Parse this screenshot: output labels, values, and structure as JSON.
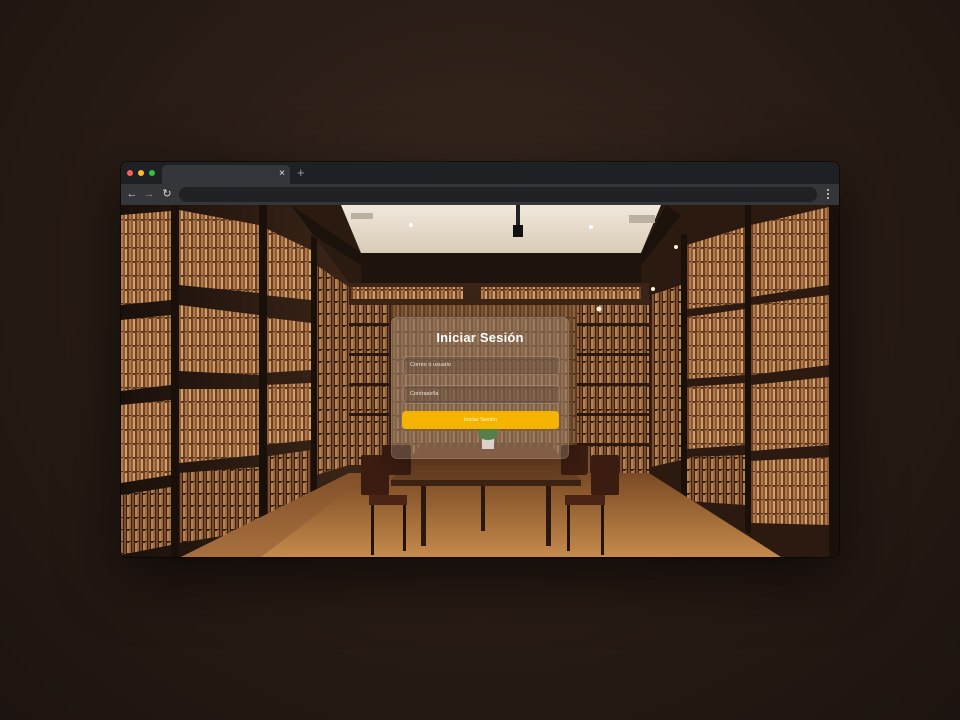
{
  "browser": {
    "tab_close": "×",
    "new_tab": "+",
    "back": "←",
    "forward": "→",
    "reload": "↻"
  },
  "login": {
    "title": "Iniciar Sesión",
    "user_placeholder": "Correo o usuario",
    "password_placeholder": "Contraseña",
    "submit_label": "Iniciar Sesión"
  },
  "colors": {
    "button": "#f5b400",
    "card": "rgba(190,175,160,0.28)"
  }
}
